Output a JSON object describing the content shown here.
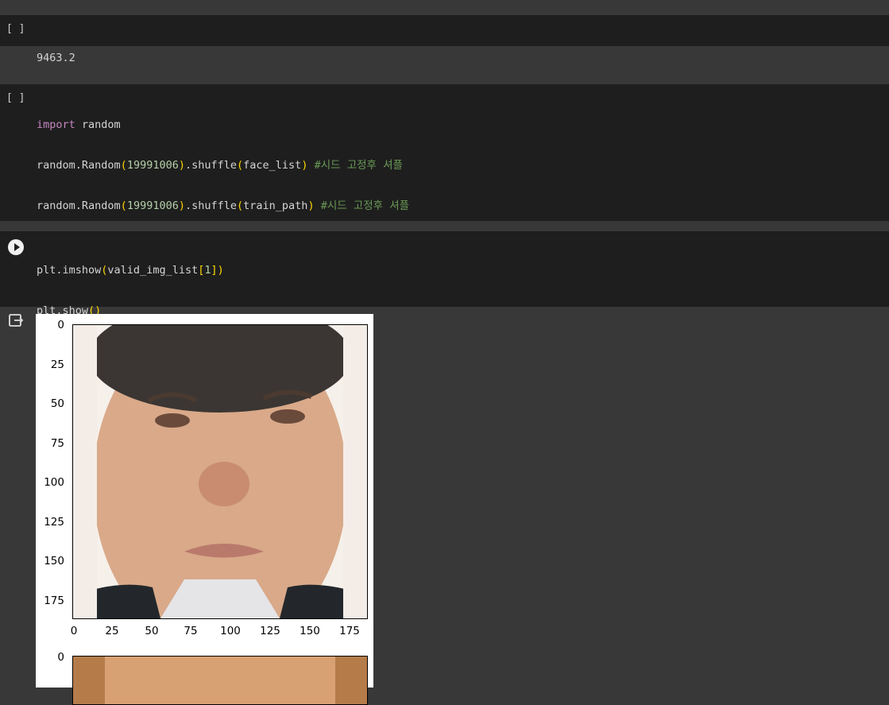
{
  "cells": {
    "c1": {
      "gutter": "[ ]",
      "output": "9463.2"
    },
    "c2": {
      "gutter": "[ ]"
    }
  },
  "plot": {
    "image1": {
      "y_ticks": [
        "0",
        "25",
        "50",
        "75",
        "100",
        "125",
        "150",
        "175"
      ],
      "x_ticks": [
        "0",
        "25",
        "50",
        "75",
        "100",
        "125",
        "150",
        "175"
      ]
    },
    "image2": {
      "y_ticks": [
        "0"
      ]
    }
  },
  "icons": {
    "run": "play-circle-icon",
    "output": "output-redirect-icon"
  }
}
